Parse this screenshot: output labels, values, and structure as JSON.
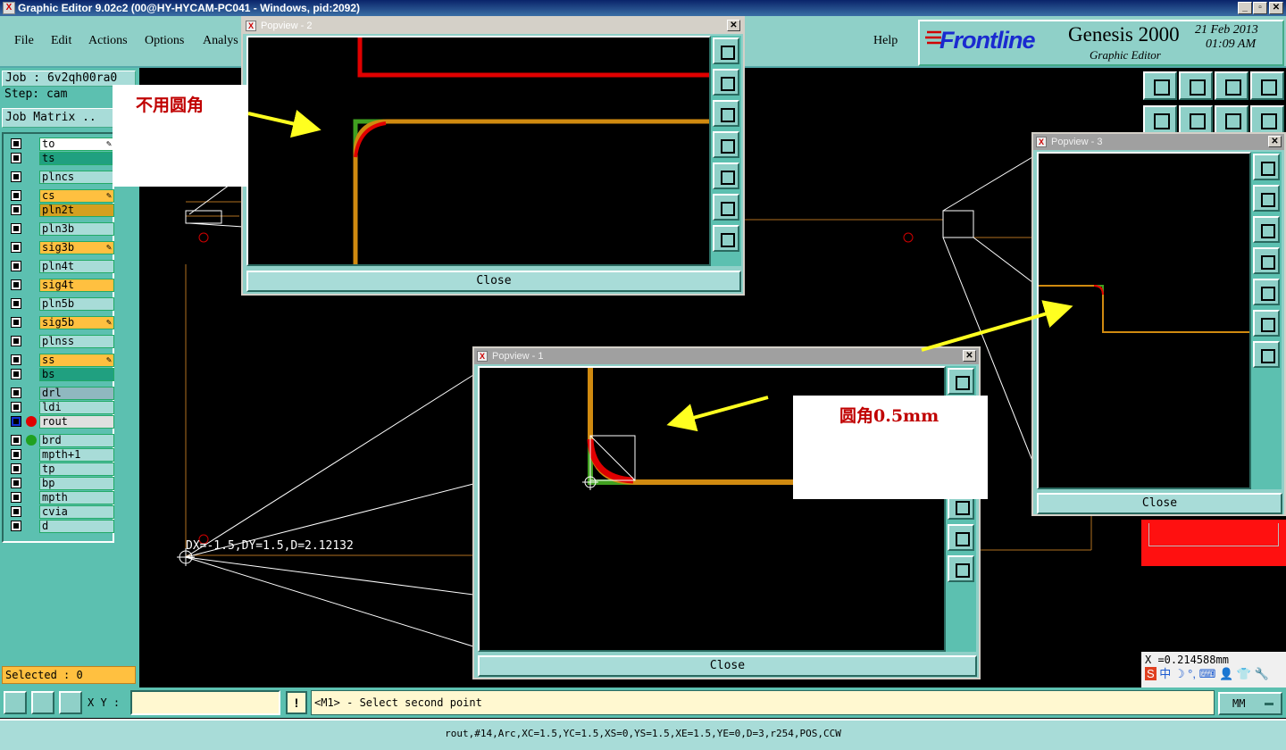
{
  "window": {
    "title": "Graphic Editor 9.02c2 (00@HY-HYCAM-PC041 - Windows, pid:2092)"
  },
  "menu": {
    "file": "File",
    "edit": "Edit",
    "actions": "Actions",
    "options": "Options",
    "analysis": "Analys",
    "help": "Help"
  },
  "brand": {
    "logo": "Frontline",
    "product": "Genesis 2000",
    "subtitle": "Graphic Editor",
    "date": "21 Feb 2013",
    "time": "01:09 AM"
  },
  "job": {
    "job_label": "Job : 6v2qh00ra0",
    "step_label": "Step: cam",
    "matrix_button": "Job Matrix ..",
    "selected": "Selected : 0"
  },
  "layers": [
    {
      "name": "to",
      "color": "#ffffff",
      "pen": true,
      "group": 0
    },
    {
      "name": "ts",
      "color": "#20a080",
      "pen": false,
      "group": 0
    },
    {
      "name": "plncs",
      "color": "#a8dcd8",
      "pen": false,
      "group": 1
    },
    {
      "name": "cs",
      "color": "#ffc040",
      "pen": true,
      "group": 2
    },
    {
      "name": "pln2t",
      "color": "#d4a020",
      "pen": false,
      "group": 2
    },
    {
      "name": "pln3b",
      "color": "#a8dcd8",
      "pen": false,
      "group": 3
    },
    {
      "name": "sig3b",
      "color": "#ffc040",
      "pen": true,
      "group": 4
    },
    {
      "name": "pln4t",
      "color": "#a8dcd8",
      "pen": false,
      "group": 5
    },
    {
      "name": "sig4t",
      "color": "#ffc040",
      "pen": false,
      "group": 6
    },
    {
      "name": "pln5b",
      "color": "#a8dcd8",
      "pen": false,
      "group": 7
    },
    {
      "name": "sig5b",
      "color": "#ffc040",
      "pen": true,
      "group": 8
    },
    {
      "name": "plnss",
      "color": "#a8dcd8",
      "pen": false,
      "group": 9
    },
    {
      "name": "ss",
      "color": "#ffc040",
      "pen": true,
      "group": 10
    },
    {
      "name": "bs",
      "color": "#20a080",
      "pen": false,
      "group": 10
    },
    {
      "name": "drl",
      "color": "#90b8c0",
      "pen": false,
      "group": 11
    },
    {
      "name": "ldi",
      "color": "#a8dcd8",
      "pen": false,
      "group": 11
    },
    {
      "name": "rout",
      "color": "#e0e0e0",
      "pen": false,
      "group": 11,
      "dot": "#e00000",
      "active": true
    },
    {
      "name": "brd",
      "color": "#a8dcd8",
      "pen": false,
      "group": 12,
      "dot": "#20a020"
    },
    {
      "name": "mpth+1",
      "color": "#a8dcd8",
      "pen": false,
      "group": 12
    },
    {
      "name": "tp",
      "color": "#a8dcd8",
      "pen": false,
      "group": 12
    },
    {
      "name": "bp",
      "color": "#a8dcd8",
      "pen": false,
      "group": 12
    },
    {
      "name": "mpth",
      "color": "#a8dcd8",
      "pen": false,
      "group": 12
    },
    {
      "name": "cvia",
      "color": "#a8dcd8",
      "pen": false,
      "group": 12
    },
    {
      "name": "d",
      "color": "#a8dcd8",
      "pen": false,
      "group": 12
    }
  ],
  "canvas": {
    "measure_text": "DX=-1.5,DY=1.5,D=2.12132",
    "coord_readout": "X =0.214588mm"
  },
  "popviews": {
    "p1": {
      "title": "Popview - 1",
      "close": "Close"
    },
    "p2": {
      "title": "Popview - 2",
      "close": "Close"
    },
    "p3": {
      "title": "Popview - 3",
      "close": "Close"
    }
  },
  "notes": {
    "no_fillet": "不用圆角",
    "fillet": "圆角0.5mm"
  },
  "command": {
    "xy_label": "X Y :",
    "xy_value": "",
    "prompt": "<M1> - Select second point",
    "units": "MM"
  },
  "status": {
    "feature_info": "rout,#14,Arc,XC=1.5,YC=1.5,XS=0,YS=1.5,XE=1.5,YE=0,D=3,r254,POS,CCW"
  },
  "colors": {
    "panel": "#5cc0b0",
    "accent": "#8fd0c8",
    "trace_orange": "#d08a10",
    "trace_red": "#e00000",
    "trace_green": "#40a020",
    "arrow_yellow": "#ffff20"
  }
}
